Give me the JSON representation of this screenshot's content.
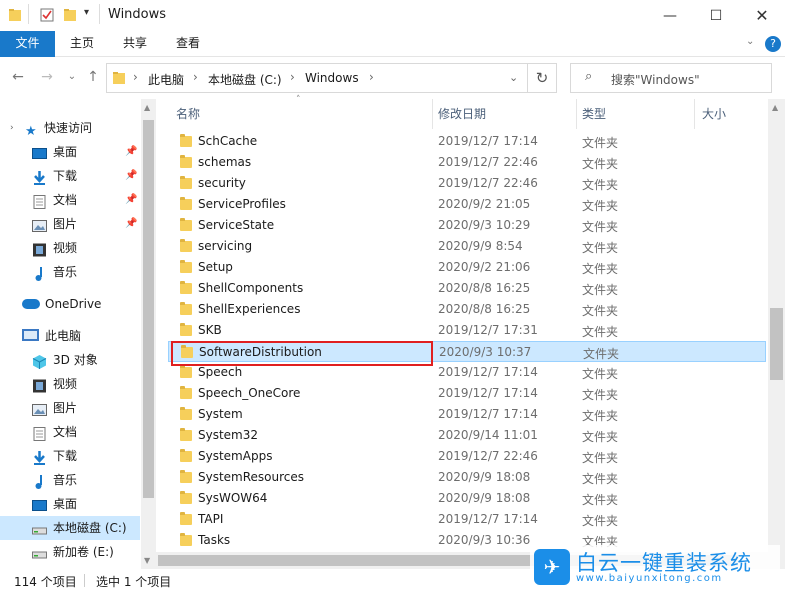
{
  "window": {
    "title": "Windows"
  },
  "ribbon": {
    "tabs": [
      "文件",
      "主页",
      "共享",
      "查看"
    ]
  },
  "address": {
    "breadcrumbs": [
      "此电脑",
      "本地磁盘 (C:)",
      "Windows"
    ],
    "search_placeholder": "搜索\"Windows\""
  },
  "nav": {
    "quick_access": "快速访问",
    "quick_items": [
      {
        "label": "桌面",
        "icon": "desktop-icon",
        "pinned": true
      },
      {
        "label": "下载",
        "icon": "download-icon",
        "pinned": true
      },
      {
        "label": "文档",
        "icon": "documents-icon",
        "pinned": true
      },
      {
        "label": "图片",
        "icon": "pictures-icon",
        "pinned": true
      },
      {
        "label": "视频",
        "icon": "videos-icon",
        "pinned": false
      },
      {
        "label": "音乐",
        "icon": "music-icon",
        "pinned": false
      }
    ],
    "onedrive": "OneDrive",
    "this_pc": "此电脑",
    "pc_items": [
      {
        "label": "3D 对象",
        "icon": "3d-objects-icon"
      },
      {
        "label": "视频",
        "icon": "videos-icon"
      },
      {
        "label": "图片",
        "icon": "pictures-icon"
      },
      {
        "label": "文档",
        "icon": "documents-icon"
      },
      {
        "label": "下载",
        "icon": "download-icon"
      },
      {
        "label": "音乐",
        "icon": "music-icon"
      },
      {
        "label": "桌面",
        "icon": "desktop-icon"
      },
      {
        "label": "本地磁盘 (C:)",
        "icon": "drive-icon"
      },
      {
        "label": "新加卷 (E:)",
        "icon": "drive-icon"
      }
    ]
  },
  "columns": {
    "name": "名称",
    "date": "修改日期",
    "type": "类型",
    "size": "大小"
  },
  "files": [
    {
      "name": "SchCache",
      "date": "2019/12/7 17:14",
      "type": "文件夹"
    },
    {
      "name": "schemas",
      "date": "2019/12/7 22:46",
      "type": "文件夹"
    },
    {
      "name": "security",
      "date": "2019/12/7 22:46",
      "type": "文件夹"
    },
    {
      "name": "ServiceProfiles",
      "date": "2020/9/2 21:05",
      "type": "文件夹"
    },
    {
      "name": "ServiceState",
      "date": "2020/9/3 10:29",
      "type": "文件夹"
    },
    {
      "name": "servicing",
      "date": "2020/9/9 8:54",
      "type": "文件夹"
    },
    {
      "name": "Setup",
      "date": "2020/9/2 21:06",
      "type": "文件夹"
    },
    {
      "name": "ShellComponents",
      "date": "2020/8/8 16:25",
      "type": "文件夹"
    },
    {
      "name": "ShellExperiences",
      "date": "2020/8/8 16:25",
      "type": "文件夹"
    },
    {
      "name": "SKB",
      "date": "2019/12/7 17:31",
      "type": "文件夹"
    },
    {
      "name": "SoftwareDistribution",
      "date": "2020/9/3 10:37",
      "type": "文件夹",
      "selected": true
    },
    {
      "name": "Speech",
      "date": "2019/12/7 17:14",
      "type": "文件夹"
    },
    {
      "name": "Speech_OneCore",
      "date": "2019/12/7 17:14",
      "type": "文件夹"
    },
    {
      "name": "System",
      "date": "2019/12/7 17:14",
      "type": "文件夹"
    },
    {
      "name": "System32",
      "date": "2020/9/14 11:01",
      "type": "文件夹"
    },
    {
      "name": "SystemApps",
      "date": "2019/12/7 22:46",
      "type": "文件夹"
    },
    {
      "name": "SystemResources",
      "date": "2020/9/9 18:08",
      "type": "文件夹"
    },
    {
      "name": "SysWOW64",
      "date": "2020/9/9 18:08",
      "type": "文件夹"
    },
    {
      "name": "TAPI",
      "date": "2019/12/7 17:14",
      "type": "文件夹"
    },
    {
      "name": "Tasks",
      "date": "2020/9/3 10:36",
      "type": "文件夹"
    }
  ],
  "status": {
    "count": "114 个项目",
    "selected": "选中 1 个项目"
  },
  "watermark": {
    "title": "白云一键重装系统",
    "url": "www.baiyunxitong.com"
  },
  "colors": {
    "accent": "#1979ca",
    "selection": "#cce8ff",
    "highlight_box": "#e02020",
    "folder": "#f6cf5b"
  }
}
